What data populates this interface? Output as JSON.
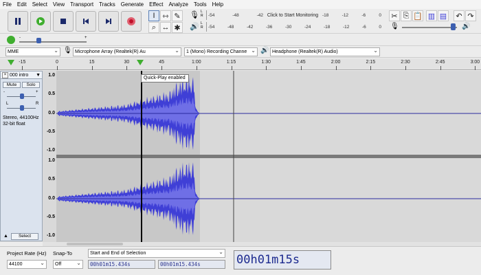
{
  "menu": [
    "File",
    "Edit",
    "Select",
    "View",
    "Transport",
    "Tracks",
    "Generate",
    "Effect",
    "Analyze",
    "Tools",
    "Help"
  ],
  "meters": {
    "record_ticks": [
      "-54",
      "-48",
      "-42"
    ],
    "record_click": "Click to Start Monitoring",
    "record_ticks_right": [
      "-18",
      "-12",
      "-6",
      "0"
    ],
    "playback_ticks": [
      "-54",
      "-48",
      "-42",
      "-36",
      "-30",
      "-24",
      "-18",
      "-12",
      "-6",
      "0"
    ],
    "record_label": "L\nR",
    "play_label": "L\nR"
  },
  "device": {
    "host": "MME",
    "recording_device": "Microphone Array (Realtek(R) Au",
    "channels": "1 (Mono) Recording Channe",
    "playback_device": "Headphone (Realtek(R) Audio)"
  },
  "ruler": [
    "-15",
    "0",
    "15",
    "30",
    "45",
    "1:00",
    "1:15",
    "1:30",
    "1:45",
    "2:00",
    "2:15",
    "2:30",
    "2:45",
    "3:00"
  ],
  "tooltip": "Quick-Play enabled",
  "track": {
    "name": "000 intro",
    "mute": "Mute",
    "solo": "Solo",
    "minus": "-",
    "plus": "+",
    "left": "L",
    "right": "R",
    "info": "Stereo, 44100Hz\n32-bit float",
    "select": "Select",
    "scale": [
      "1.0",
      "0.5",
      "0.0",
      "-0.5",
      "-1.0"
    ]
  },
  "bottom": {
    "project_rate_label": "Project Rate (Hz)",
    "project_rate": "44100",
    "snap_label": "Snap-To",
    "snap": "Off",
    "selection_mode": "Start and End of Selection",
    "start_time": "00h01m15.434s",
    "end_time": "00h01m15.434s",
    "big_time": "00h01m15s"
  },
  "colors": {
    "waveform": "#3f3fd6",
    "selection": "#c8c8c8",
    "background": "#d9d9d9",
    "time_digits": "#1c2a8f"
  }
}
